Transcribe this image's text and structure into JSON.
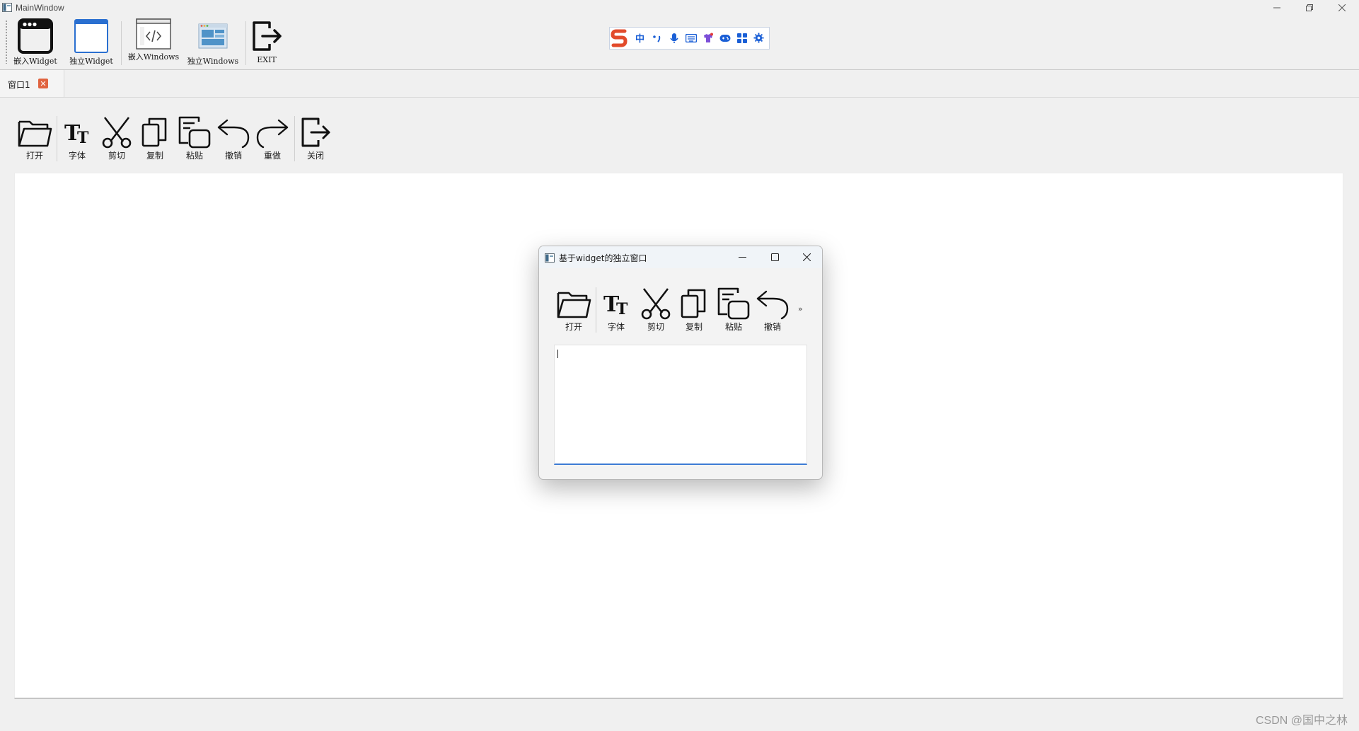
{
  "window": {
    "title": "MainWindow",
    "controls": [
      "minimize",
      "restore",
      "close"
    ]
  },
  "main_toolbar": {
    "items": [
      {
        "label": "嵌入Widget",
        "icon": "embedded-window-icon"
      },
      {
        "label": "独立Widget",
        "icon": "standalone-window-icon"
      },
      {
        "label": "嵌入Windows",
        "icon": "code-window-icon"
      },
      {
        "label": "独立Windows",
        "icon": "tiled-window-icon"
      },
      {
        "label": "EXIT",
        "icon": "exit-icon"
      }
    ]
  },
  "ime_bar": {
    "logo": "sogou-s-logo",
    "mode_label": "中",
    "icons": [
      "punctuation-icon",
      "microphone-icon",
      "keyboard-icon",
      "skin-icon",
      "gamepad-icon",
      "apps-grid-icon",
      "settings-icon"
    ]
  },
  "tabs": [
    {
      "label": "窗口1",
      "active": true,
      "close_icon": "close-icon"
    }
  ],
  "editor_toolbar": {
    "items": [
      {
        "label": "打开",
        "icon": "folder-open-icon"
      },
      {
        "label": "字体",
        "icon": "font-icon"
      },
      {
        "label": "剪切",
        "icon": "scissors-icon"
      },
      {
        "label": "复制",
        "icon": "copy-icon"
      },
      {
        "label": "粘贴",
        "icon": "paste-icon"
      },
      {
        "label": "撤销",
        "icon": "undo-icon"
      },
      {
        "label": "重做",
        "icon": "redo-icon"
      },
      {
        "label": "关闭",
        "icon": "exit-icon"
      }
    ]
  },
  "dialog": {
    "title": "基于widget的独立窗口",
    "controls": [
      "minimize",
      "maximize",
      "close"
    ],
    "toolbar": {
      "items": [
        {
          "label": "打开",
          "icon": "folder-open-icon"
        },
        {
          "label": "字体",
          "icon": "font-icon"
        },
        {
          "label": "剪切",
          "icon": "scissors-icon"
        },
        {
          "label": "复制",
          "icon": "copy-icon"
        },
        {
          "label": "粘贴",
          "icon": "paste-icon"
        },
        {
          "label": "撤销",
          "icon": "undo-icon"
        }
      ],
      "overflow": "»"
    },
    "text_value": ""
  },
  "watermark": "CSDN @国中之林"
}
